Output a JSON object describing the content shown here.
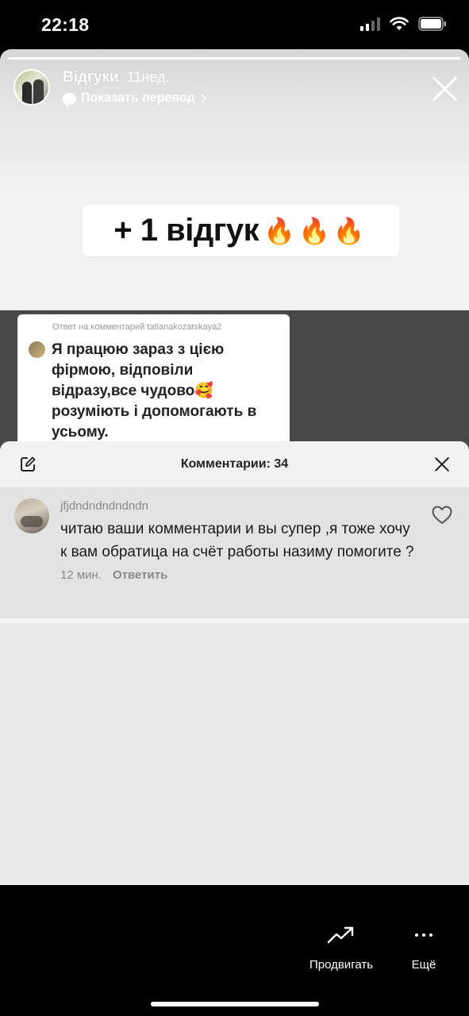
{
  "status_bar": {
    "time": "22:18"
  },
  "story": {
    "title": "Відгуки",
    "age": "11нед.",
    "translate_label": "Показать перевод",
    "sticker_text": "+ 1 відгук",
    "sticker_emoji": "🔥🔥🔥",
    "reply_card": {
      "meta": "Ответ на комментарий tatianakozatskaya2",
      "text": "Я працюю зараз з цією фірмою, відповіли відразу,все чудово🥰 розуміють і допомогають в усьому."
    }
  },
  "comments_sheet": {
    "title": "Комментарии: 34",
    "comments": [
      {
        "user": "jfjdndndndndndn",
        "text": "читаю ваши комментарии и вы супер ,я тоже хочу к вам обратица на счёт работы назиму помогите ?",
        "time": "12 мин.",
        "reply_label": "Ответить"
      }
    ]
  },
  "bottom_bar": {
    "promote_label": "Продвигать",
    "more_label": "Ещё"
  },
  "icons": [
    "edit-icon",
    "close-icon",
    "heart-icon",
    "trending-icon",
    "more-dots-icon",
    "wifi-icon",
    "battery-icon",
    "signal-icon",
    "chevron-right-icon",
    "translate-bubble-icon"
  ]
}
